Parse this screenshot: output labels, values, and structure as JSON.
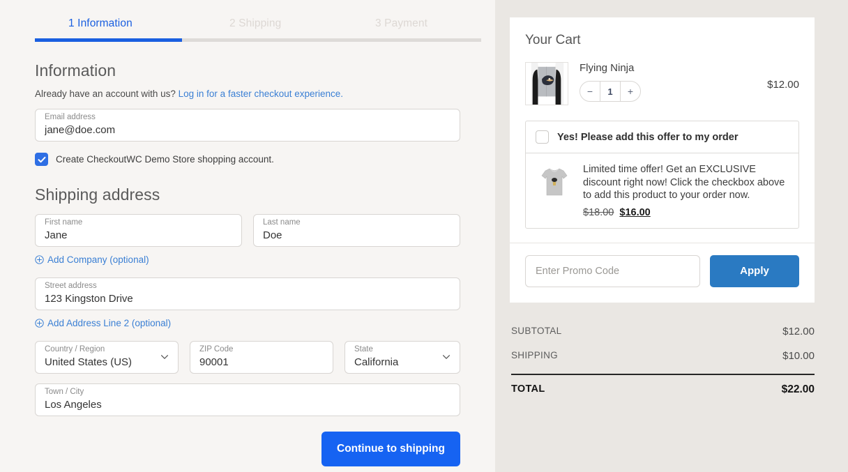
{
  "steps": [
    {
      "num": "1",
      "label": "Information",
      "state": "active"
    },
    {
      "num": "2",
      "label": "Shipping",
      "state": "inactive"
    },
    {
      "num": "3",
      "label": "Payment",
      "state": "inactive"
    }
  ],
  "progress_percent": 33,
  "information": {
    "heading": "Information",
    "account_prompt": "Already have an account with us?",
    "login_link": "Log in for a faster checkout experience.",
    "email_field": {
      "label": "Email address",
      "value": "jane@doe.com",
      "placeholder": "Email address"
    },
    "create_account_label": "Create CheckoutWC Demo Store shopping account.",
    "create_account_checked": true
  },
  "shipping_address": {
    "heading": "Shipping address",
    "first_name": {
      "label": "First name",
      "value": "Jane"
    },
    "last_name": {
      "label": "Last name",
      "value": "Doe"
    },
    "add_company_link": "Add Company (optional)",
    "street": {
      "label": "Street address",
      "value": "123 Kingston Drive"
    },
    "add_address_line2_link": "Add Address Line 2 (optional)",
    "country": {
      "label": "Country / Region",
      "value": "United States (US)"
    },
    "zip": {
      "label": "ZIP Code",
      "value": "90001"
    },
    "state": {
      "label": "State",
      "value": "California"
    },
    "city": {
      "label": "Town / City",
      "value": "Los Angeles"
    }
  },
  "continue_button": "Continue to shipping",
  "cart": {
    "title": "Your Cart",
    "item": {
      "name": "Flying Ninja",
      "quantity": "1",
      "price": "$12.00",
      "decrease_label": "−",
      "increase_label": "+"
    }
  },
  "offer": {
    "checkbox_label": "Yes! Please add this offer to my order",
    "checked": false,
    "description": "Limited time offer! Get an EXCLUSIVE discount right now! Click the checkbox above to add this product to your order now.",
    "old_price": "$18.00",
    "new_price": "$16.00"
  },
  "promo": {
    "placeholder": "Enter Promo Code",
    "value": "",
    "apply_label": "Apply"
  },
  "totals": [
    {
      "label": "SUBTOTAL",
      "value": "$12.00",
      "emphasis": false
    },
    {
      "label": "SHIPPING",
      "value": "$10.00",
      "emphasis": false
    },
    {
      "label": "TOTAL",
      "value": "$22.00",
      "emphasis": true
    }
  ],
  "colors": {
    "accent_blue": "#1663f2",
    "link_blue": "#3a7fd4",
    "apply_blue": "#2a7ac2",
    "left_bg": "#f7f5f3",
    "right_bg": "#eae7e3"
  }
}
